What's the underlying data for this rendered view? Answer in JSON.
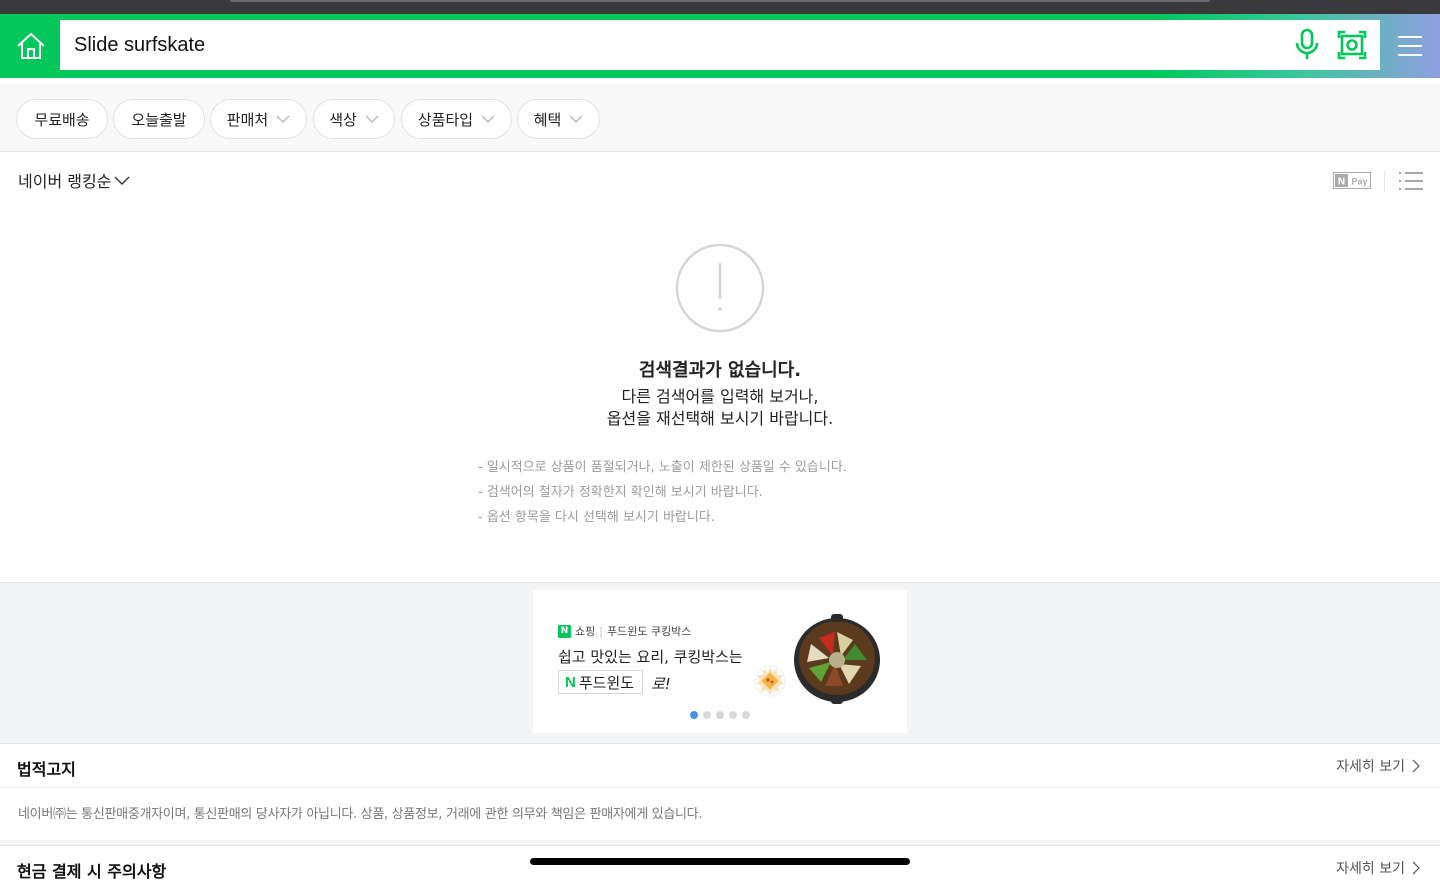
{
  "search": {
    "query": "Slide surfskate"
  },
  "filters": [
    {
      "label": "무료배송",
      "dropdown": false
    },
    {
      "label": "오늘출발",
      "dropdown": false
    },
    {
      "label": "판매처",
      "dropdown": true
    },
    {
      "label": "색상",
      "dropdown": true
    },
    {
      "label": "상품타입",
      "dropdown": true
    },
    {
      "label": "혜택",
      "dropdown": true
    }
  ],
  "sort": {
    "label": "네이버 랭킹순",
    "npay_label": "Pay"
  },
  "empty": {
    "title": "검색결과가 없습니다.",
    "desc_line1": "다른 검색어를 입력해 보거나,",
    "desc_line2": "옵션을 재선택해 보시기 바랍니다.",
    "tips": [
      "일시적으로 상품이 품절되거나, 노출이 제한된 상품일 수 있습니다.",
      "검색어의 철자가 정확한지 확인해 보시기 바랍니다.",
      "옵션 항목을 다시 선택해 보시기 바랍니다."
    ]
  },
  "banner": {
    "brand": "쇼핑",
    "sub_brand": "푸드윈도 쿠킹박스",
    "line1": "쉽고 맛있는 요리, 쿠킹박스는",
    "badge": "푸드윈도",
    "suffix": "로!",
    "slide_count": 5,
    "active_slide": 0
  },
  "legal": {
    "title": "법적고지",
    "more": "자세히 보기",
    "text": "네이버㈜는 통신판매중개자이며, 통신판매의 당사자가 아닙니다. 상품, 상품정보, 거래에 관한 의무와 책임은 판매자에게 있습니다."
  },
  "cash": {
    "title": "현금 결제 시 주의사항",
    "more": "자세히 보기"
  },
  "colors": {
    "accent": "#03c75a",
    "dot_active": "#4a90e2"
  }
}
